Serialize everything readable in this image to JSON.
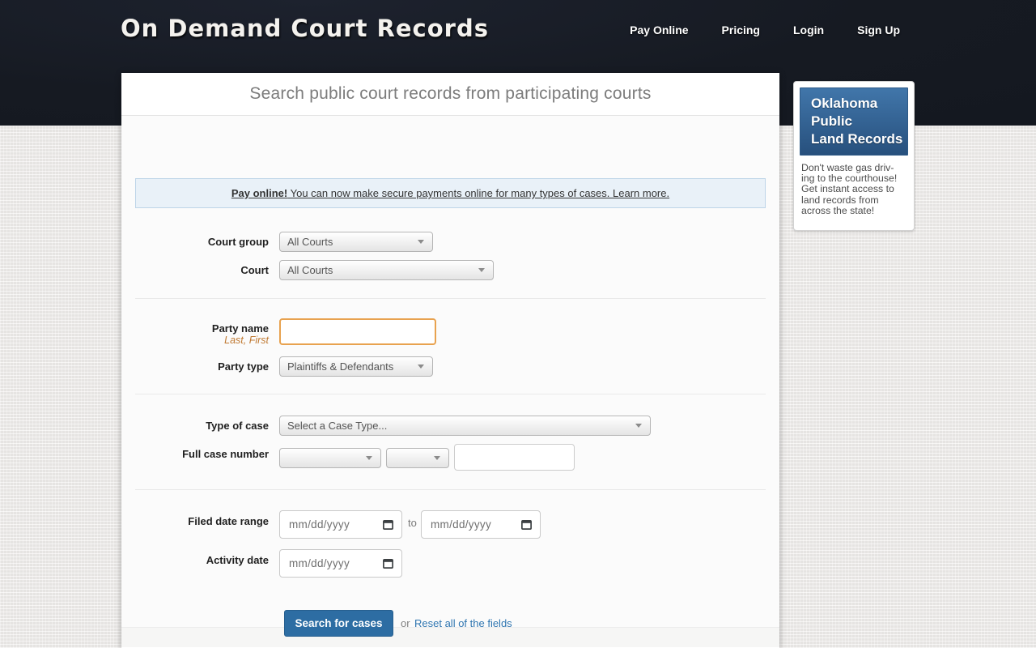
{
  "header": {
    "logo": "On Demand Court Records",
    "nav": [
      {
        "label": "Pay Online"
      },
      {
        "label": "Pricing"
      },
      {
        "label": "Login"
      },
      {
        "label": "Sign Up"
      }
    ]
  },
  "main": {
    "title": "Search public court records from participating courts",
    "banner": {
      "bold": "Pay online!",
      "rest": " You can now make secure payments online for many types of cases. Learn more."
    },
    "form": {
      "court_group": {
        "label": "Court group",
        "value": "All Courts"
      },
      "court": {
        "label": "Court",
        "value": "All Courts"
      },
      "party_name": {
        "label": "Party name",
        "hint": "Last, First",
        "value": ""
      },
      "party_type": {
        "label": "Party type",
        "value": "Plaintiffs & Defendants"
      },
      "case_type": {
        "label": "Type of case",
        "value": "Select a Case Type..."
      },
      "case_number": {
        "label": "Full case number",
        "year_value": "",
        "type_value": "",
        "number_value": ""
      },
      "filed_date": {
        "label": "Filed date range",
        "from_placeholder": "mm/dd/yyyy",
        "to_word": "to",
        "to_placeholder": "mm/dd/yyyy"
      },
      "activity_date": {
        "label": "Activity date",
        "placeholder": "mm/dd/yyyy"
      },
      "search_button": "Search for cases",
      "or_word": "or",
      "reset_link": "Reset all of the fields"
    }
  },
  "sidebar_ad": {
    "title_lines": [
      "Oklahoma",
      "Public",
      "Land Records"
    ],
    "body_lines": [
      "Don't waste gas driv-",
      "ing to the courthouse!",
      "Get instant access to",
      "land records from",
      "across the state!"
    ]
  },
  "colors": {
    "header_bg": "#161a22",
    "button_blue": "#2d6da3",
    "link_blue": "#3076b0",
    "banner_bg": "#e9f1f8",
    "party_name_border_orange": "#e8a24f",
    "hint_orange": "#c07a33",
    "ad_blue_top": "#4176aa",
    "ad_blue_bottom": "#27507d"
  }
}
